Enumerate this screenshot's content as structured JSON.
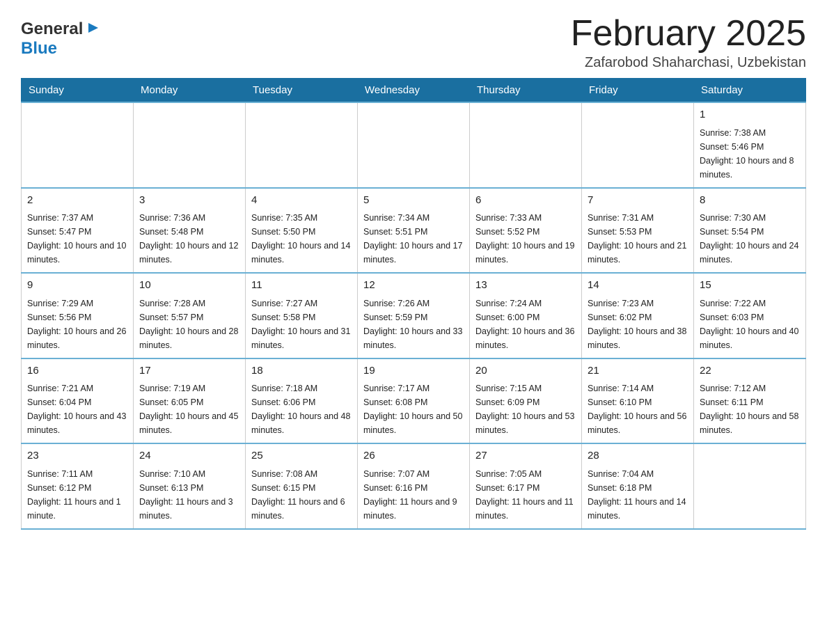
{
  "header": {
    "logo_general": "General",
    "logo_blue": "Blue",
    "month_title": "February 2025",
    "location": "Zafarobod Shaharchasi, Uzbekistan"
  },
  "weekdays": [
    "Sunday",
    "Monday",
    "Tuesday",
    "Wednesday",
    "Thursday",
    "Friday",
    "Saturday"
  ],
  "weeks": [
    [
      {
        "day": "",
        "info": ""
      },
      {
        "day": "",
        "info": ""
      },
      {
        "day": "",
        "info": ""
      },
      {
        "day": "",
        "info": ""
      },
      {
        "day": "",
        "info": ""
      },
      {
        "day": "",
        "info": ""
      },
      {
        "day": "1",
        "info": "Sunrise: 7:38 AM\nSunset: 5:46 PM\nDaylight: 10 hours and 8 minutes."
      }
    ],
    [
      {
        "day": "2",
        "info": "Sunrise: 7:37 AM\nSunset: 5:47 PM\nDaylight: 10 hours and 10 minutes."
      },
      {
        "day": "3",
        "info": "Sunrise: 7:36 AM\nSunset: 5:48 PM\nDaylight: 10 hours and 12 minutes."
      },
      {
        "day": "4",
        "info": "Sunrise: 7:35 AM\nSunset: 5:50 PM\nDaylight: 10 hours and 14 minutes."
      },
      {
        "day": "5",
        "info": "Sunrise: 7:34 AM\nSunset: 5:51 PM\nDaylight: 10 hours and 17 minutes."
      },
      {
        "day": "6",
        "info": "Sunrise: 7:33 AM\nSunset: 5:52 PM\nDaylight: 10 hours and 19 minutes."
      },
      {
        "day": "7",
        "info": "Sunrise: 7:31 AM\nSunset: 5:53 PM\nDaylight: 10 hours and 21 minutes."
      },
      {
        "day": "8",
        "info": "Sunrise: 7:30 AM\nSunset: 5:54 PM\nDaylight: 10 hours and 24 minutes."
      }
    ],
    [
      {
        "day": "9",
        "info": "Sunrise: 7:29 AM\nSunset: 5:56 PM\nDaylight: 10 hours and 26 minutes."
      },
      {
        "day": "10",
        "info": "Sunrise: 7:28 AM\nSunset: 5:57 PM\nDaylight: 10 hours and 28 minutes."
      },
      {
        "day": "11",
        "info": "Sunrise: 7:27 AM\nSunset: 5:58 PM\nDaylight: 10 hours and 31 minutes."
      },
      {
        "day": "12",
        "info": "Sunrise: 7:26 AM\nSunset: 5:59 PM\nDaylight: 10 hours and 33 minutes."
      },
      {
        "day": "13",
        "info": "Sunrise: 7:24 AM\nSunset: 6:00 PM\nDaylight: 10 hours and 36 minutes."
      },
      {
        "day": "14",
        "info": "Sunrise: 7:23 AM\nSunset: 6:02 PM\nDaylight: 10 hours and 38 minutes."
      },
      {
        "day": "15",
        "info": "Sunrise: 7:22 AM\nSunset: 6:03 PM\nDaylight: 10 hours and 40 minutes."
      }
    ],
    [
      {
        "day": "16",
        "info": "Sunrise: 7:21 AM\nSunset: 6:04 PM\nDaylight: 10 hours and 43 minutes."
      },
      {
        "day": "17",
        "info": "Sunrise: 7:19 AM\nSunset: 6:05 PM\nDaylight: 10 hours and 45 minutes."
      },
      {
        "day": "18",
        "info": "Sunrise: 7:18 AM\nSunset: 6:06 PM\nDaylight: 10 hours and 48 minutes."
      },
      {
        "day": "19",
        "info": "Sunrise: 7:17 AM\nSunset: 6:08 PM\nDaylight: 10 hours and 50 minutes."
      },
      {
        "day": "20",
        "info": "Sunrise: 7:15 AM\nSunset: 6:09 PM\nDaylight: 10 hours and 53 minutes."
      },
      {
        "day": "21",
        "info": "Sunrise: 7:14 AM\nSunset: 6:10 PM\nDaylight: 10 hours and 56 minutes."
      },
      {
        "day": "22",
        "info": "Sunrise: 7:12 AM\nSunset: 6:11 PM\nDaylight: 10 hours and 58 minutes."
      }
    ],
    [
      {
        "day": "23",
        "info": "Sunrise: 7:11 AM\nSunset: 6:12 PM\nDaylight: 11 hours and 1 minute."
      },
      {
        "day": "24",
        "info": "Sunrise: 7:10 AM\nSunset: 6:13 PM\nDaylight: 11 hours and 3 minutes."
      },
      {
        "day": "25",
        "info": "Sunrise: 7:08 AM\nSunset: 6:15 PM\nDaylight: 11 hours and 6 minutes."
      },
      {
        "day": "26",
        "info": "Sunrise: 7:07 AM\nSunset: 6:16 PM\nDaylight: 11 hours and 9 minutes."
      },
      {
        "day": "27",
        "info": "Sunrise: 7:05 AM\nSunset: 6:17 PM\nDaylight: 11 hours and 11 minutes."
      },
      {
        "day": "28",
        "info": "Sunrise: 7:04 AM\nSunset: 6:18 PM\nDaylight: 11 hours and 14 minutes."
      },
      {
        "day": "",
        "info": ""
      }
    ]
  ]
}
